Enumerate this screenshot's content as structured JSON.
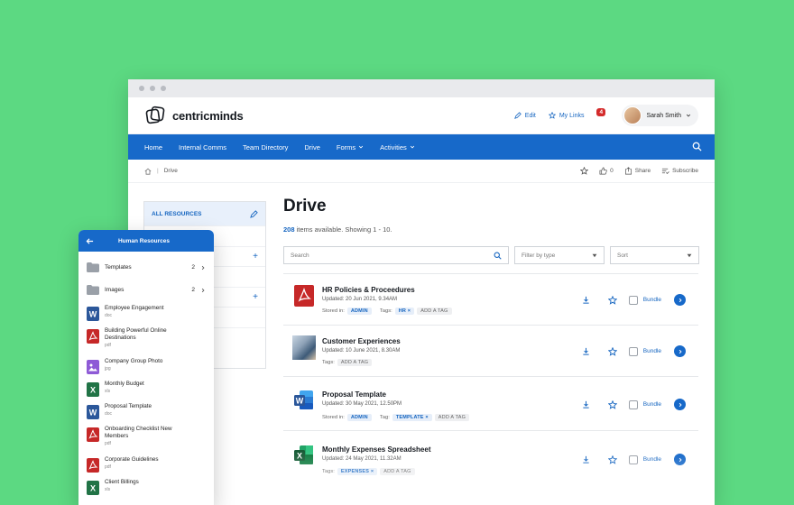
{
  "brand": {
    "name": "centricminds"
  },
  "topbar": {
    "edit_label": "Edit",
    "mylinks_label": "My Links",
    "notification_count": "4",
    "user_name": "Sarah Smith"
  },
  "nav": {
    "items": [
      "Home",
      "Internal Comms",
      "Team Directory",
      "Drive",
      "Forms",
      "Activities"
    ]
  },
  "breadcrumb": {
    "current": "Drive",
    "like_count": "0",
    "share_label": "Share",
    "subscribe_label": "Subscribe"
  },
  "left_panel": {
    "header": "ALL RESOURCES"
  },
  "drive": {
    "title": "Drive",
    "count": "208",
    "count_suffix": "items available. Showing 1 - 10.",
    "search_placeholder": "Search",
    "filter_type_label": "Filter by type",
    "sort_label": "Sort"
  },
  "files": [
    {
      "name": "HR Policies & Proceedures",
      "updated": "Updated: 20 Jun 2021, 9.34AM",
      "stored_label": "Stored in:",
      "stored": "ADMIN",
      "tags_label": "Tags:",
      "tag": "HR",
      "add_tag": "ADD A TAG",
      "bundle": "Bundle",
      "icon": "pdf-icon"
    },
    {
      "name": "Customer Experiences",
      "updated": "Updated: 10 June 2021, 8.30AM",
      "tags_label": "Tags:",
      "add_tag": "ADD A TAG",
      "bundle": "Bundle",
      "icon": "photo-thumbnail"
    },
    {
      "name": "Proposal Template",
      "updated": "Updated: 30 May 2021, 12.50PM",
      "stored_label": "Stored in:",
      "stored": "ADMIN",
      "tags_label": "Tag:",
      "tag": "TEMPLATE",
      "add_tag": "ADD A TAG",
      "bundle": "Bundle",
      "icon": "word-icon"
    },
    {
      "name": "Monthly Expenses Spreadsheet",
      "updated": "Updated: 24 May 2021, 11.32AM",
      "tags_label": "Tags:",
      "tag": "EXPENSES",
      "add_tag": "ADD A TAG",
      "bundle": "Bundle",
      "icon": "excel-icon"
    }
  ],
  "mobile": {
    "title": "Human Resources",
    "folders": [
      {
        "name": "Templates",
        "count": "2"
      },
      {
        "name": "Images",
        "count": "2"
      }
    ],
    "files": [
      {
        "name": "Employee Engagement",
        "type": "doc",
        "icon": "word-icon"
      },
      {
        "name": "Building Powerful Online Destinations",
        "type": "pdf",
        "icon": "pdf-icon"
      },
      {
        "name": "Company Group Photo",
        "type": "jpg",
        "icon": "image-icon"
      },
      {
        "name": "Monthly Budget",
        "type": "xls",
        "icon": "excel-icon"
      },
      {
        "name": "Proposal Template",
        "type": "doc",
        "icon": "word-icon"
      },
      {
        "name": "Onboarding Checklist New Members",
        "type": "pdf",
        "icon": "pdf-icon"
      },
      {
        "name": "Corporate Guidelines",
        "type": "pdf",
        "icon": "pdf-icon"
      },
      {
        "name": "Client Billings",
        "type": "xls",
        "icon": "excel-icon"
      }
    ]
  },
  "colors": {
    "background": "#5cd982",
    "primary": "#1769c9",
    "pdf": "#c62828",
    "word": "#2b579a",
    "excel": "#217346",
    "image": "#8e5ad6"
  }
}
